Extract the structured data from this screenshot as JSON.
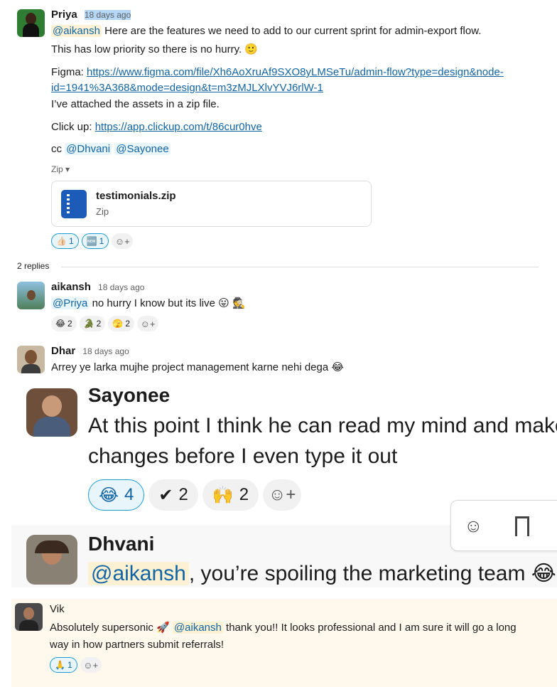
{
  "priya": {
    "name": "Priya",
    "time": "18 days ago",
    "mention_aikansh": "@aikansh",
    "line1": " Here are the features we need to add to our current sprint for admin-export flow.",
    "line2": "This has low priority so there is no hurry. 🙂",
    "figma_label": "Figma: ",
    "figma_link_1": "https://www.figma.com/file/Xh6AoXruAf9SXO8yLMSeTu/admin-flow?type=design&node-",
    "figma_link_2": "id=1941%3A368&mode=design&t=m3zMJLXlvYVJ6rlW-1",
    "assets": "I’ve attached the assets in a zip file.",
    "clickup_label": "Click up: ",
    "clickup_link": "https://app.clickup.com/t/86cur0hve",
    "cc": "cc ",
    "mention_dhvani": "@Dhvani",
    "mention_sayonee": "@Sayonee",
    "zip_label": "Zip ▾",
    "file_name": "testimonials.zip",
    "file_type": "Zip",
    "reactions": [
      {
        "emoji": "👍🏻",
        "count": "1"
      },
      {
        "emoji": "🆕",
        "count": "1"
      }
    ]
  },
  "replies": {
    "count": "2 replies"
  },
  "aikansh": {
    "name": "aikansh",
    "time": "18 days ago",
    "mention": "@Priya",
    "text": " no hurry I know but its live 😛 🕵️",
    "reactions": [
      {
        "emoji": "😂",
        "count": "2"
      },
      {
        "emoji": "🐊",
        "count": "2"
      },
      {
        "emoji": "🫣",
        "count": "2"
      }
    ]
  },
  "dhar": {
    "name": "Dhar",
    "time": "18 days ago",
    "text": "Arrey ye larka mujhe project management karne nehi dega 😂"
  },
  "sayonee": {
    "name": "Sayonee",
    "line1": "At this point I think he can read my mind and make",
    "line2": "changes before I even type it out",
    "reactions": [
      {
        "emoji": "😂",
        "count": "4"
      },
      {
        "emoji": "✔",
        "count": "2"
      },
      {
        "emoji": "🙌",
        "count": "2"
      }
    ]
  },
  "dhvani": {
    "name": "Dhvani",
    "mention": "@aikansh",
    "text": ", you’re spoiling the marketing team 😂"
  },
  "vik": {
    "name": "Vik",
    "pre": "Absolutely supersonic 🚀 ",
    "mention": "@aikansh",
    "post": " thank you!! It looks professional and I am sure it will go a long",
    "line2": "way in how partners submit referrals!",
    "reactions": [
      {
        "emoji": "🙏",
        "count": "1"
      }
    ]
  },
  "colors": {
    "link": "#1264a3",
    "mention_bg": "#fcf1d3",
    "highlight_bg": "#fef9ec",
    "hover_bg": "#f8f8f8"
  }
}
